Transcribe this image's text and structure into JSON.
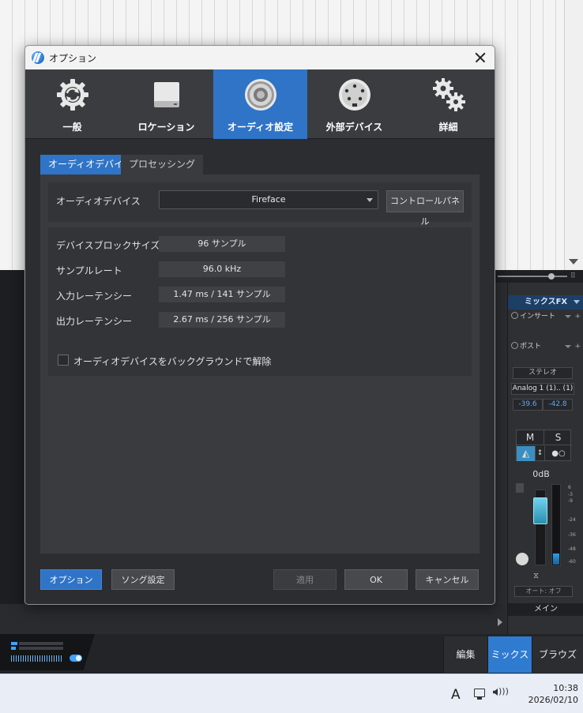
{
  "dialog": {
    "title": "オプション",
    "categories": [
      {
        "label": "一般",
        "icon": "gear-sync-icon"
      },
      {
        "label": "ロケーション",
        "icon": "drive-icon"
      },
      {
        "label": "オーディオ設定",
        "icon": "speaker-icon"
      },
      {
        "label": "外部デバイス",
        "icon": "midi-port-icon"
      },
      {
        "label": "詳細",
        "icon": "gears-icon"
      }
    ],
    "active_category": "オーディオ設定",
    "tabs": [
      "オーディオデバイス",
      "プロセッシング"
    ],
    "active_tab": "オーディオデバイス",
    "device": {
      "label": "オーディオデバイス",
      "selected": "Fireface",
      "control_panel_label": "コントロールパネル"
    },
    "info": {
      "block_size_label": "デバイスブロックサイズ",
      "block_size_value": "96 サンプル",
      "sample_rate_label": "サンプルレート",
      "sample_rate_value": "96.0 kHz",
      "input_latency_label": "入力レーテンシー",
      "input_latency_value": "1.47 ms / 141 サンプル",
      "output_latency_label": "出力レーテンシー",
      "output_latency_value": "2.67 ms / 256 サンプル",
      "release_checkbox_label": "オーディオデバイスをバックグラウンドで解除",
      "release_checked": false
    },
    "buttons": {
      "options": "オプション",
      "song_settings": "ソング設定",
      "apply": "適用",
      "ok": "OK",
      "cancel": "キャンセル"
    }
  },
  "mixer": {
    "fx_header": "ミックスFX",
    "insert_label": "インサート",
    "post_label": "ポスト",
    "stereo_label": "ステレオ",
    "input_label": "Analog 1 (1).. (1)",
    "peak_left": "-39.6",
    "peak_right": "-42.8",
    "mute_label": "M",
    "solo_label": "S",
    "gain_label": "0dB",
    "automation_label": "オート: オフ",
    "channel_name": "メイン",
    "scale": [
      "6",
      "-3",
      "-9",
      "-24",
      "-36",
      "-48",
      "-60"
    ]
  },
  "bottom_bar": {
    "edit_label": "編集",
    "mix_label": "ミックス",
    "browse_label": "ブラウズ",
    "active": "ミックス"
  },
  "taskbar": {
    "ime_indicator": "A",
    "time": "10:38",
    "date": "2026/02/10"
  },
  "colors": {
    "accent": "#2f74c6",
    "dialog_bg": "#2c2d30",
    "panel_bg": "#3a3b3f"
  }
}
